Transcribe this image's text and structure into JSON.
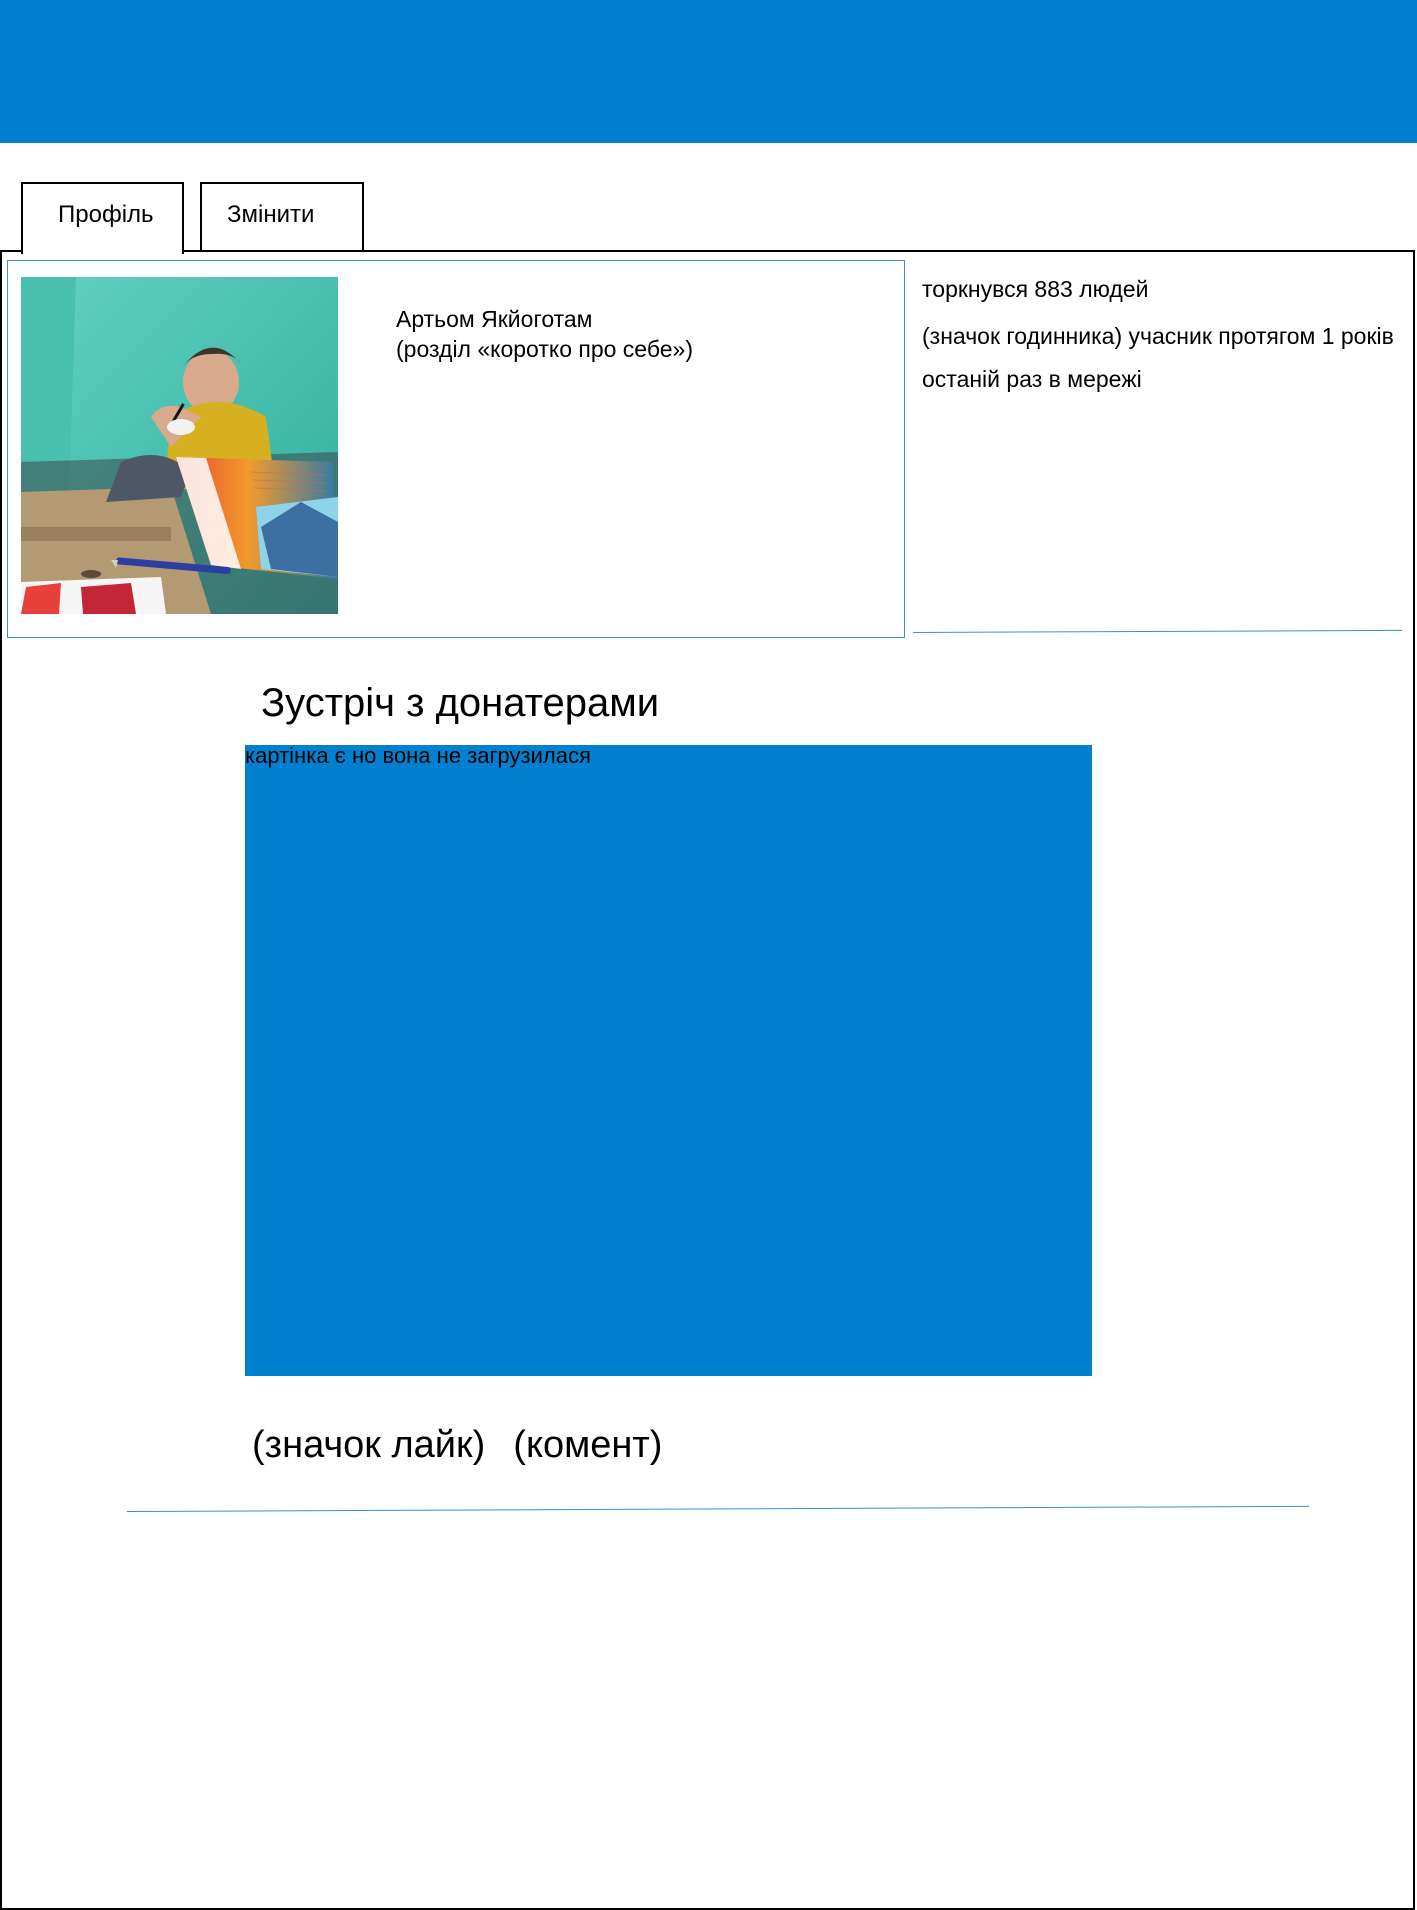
{
  "colors": {
    "accent": "#0180cf",
    "line": "#3a8fd6"
  },
  "tabs": [
    {
      "label": "Профіль",
      "active": true
    },
    {
      "label": "Змінити",
      "active": false
    }
  ],
  "profile": {
    "name": "Артьом Якйоготам",
    "about": "(розділ «коротко про себе»)",
    "avatar_icon": "user-photo"
  },
  "stats": {
    "touched": "торкнувся 883 людей",
    "member": "(значок годинника) учасник протягом 1 років",
    "last_online": "останій раз в мережі"
  },
  "post": {
    "title": "Зустріч з донатерами",
    "image_caption": "картінка є но вона не загрузилася",
    "like": "(значок лайк)",
    "comment": "(комент)"
  }
}
